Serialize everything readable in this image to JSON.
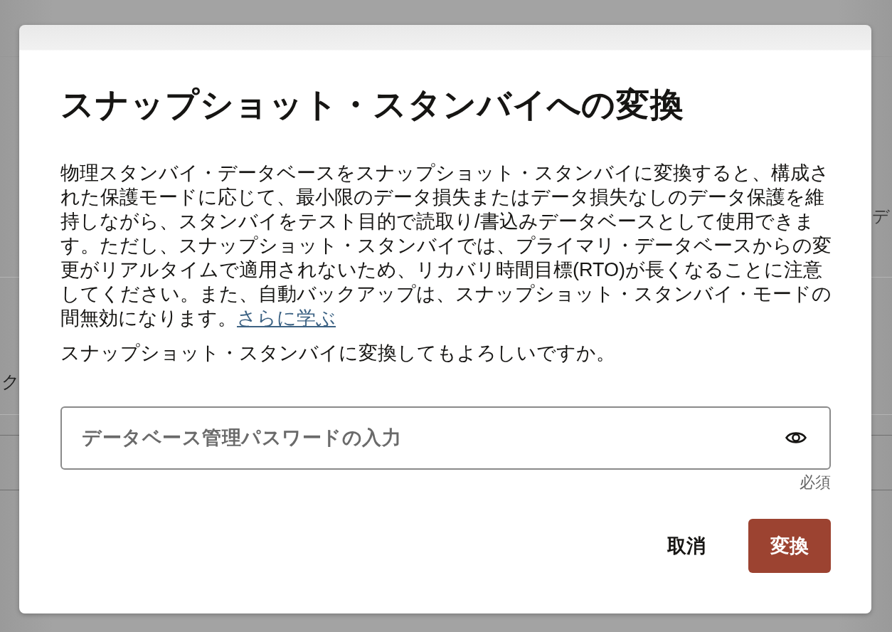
{
  "background": {
    "table": {
      "rows": [
        {
          "last_cell": "デ"
        },
        {
          "first_cell": "ク"
        }
      ]
    }
  },
  "dialog": {
    "title": "スナップショット・スタンバイへの変換",
    "description": "物理スタンバイ・データベースをスナップショット・スタンバイに変換すると、構成された保護モードに応じて、最小限のデータ損失またはデータ損失なしのデータ保護を維持しながら、スタンバイをテスト目的で読取り/書込みデータベースとして使用できます。ただし、スナップショット・スタンバイでは、プライマリ・データベースからの変更がリアルタイムで適用されないため、リカバリ時間目標(RTO)が長くなることに注意してください。また、自動バックアップは、スナップショット・スタンバイ・モードの間無効になります。",
    "learn_more_link": "さらに学ぶ",
    "question": "スナップショット・スタンバイに変換してもよろしいですか。",
    "password_field": {
      "placeholder": "データベース管理パスワードの入力",
      "hint": "必須"
    },
    "buttons": [
      {
        "label": "取消",
        "kind": "text"
      },
      {
        "label": "変換",
        "kind": "primary"
      }
    ]
  }
}
